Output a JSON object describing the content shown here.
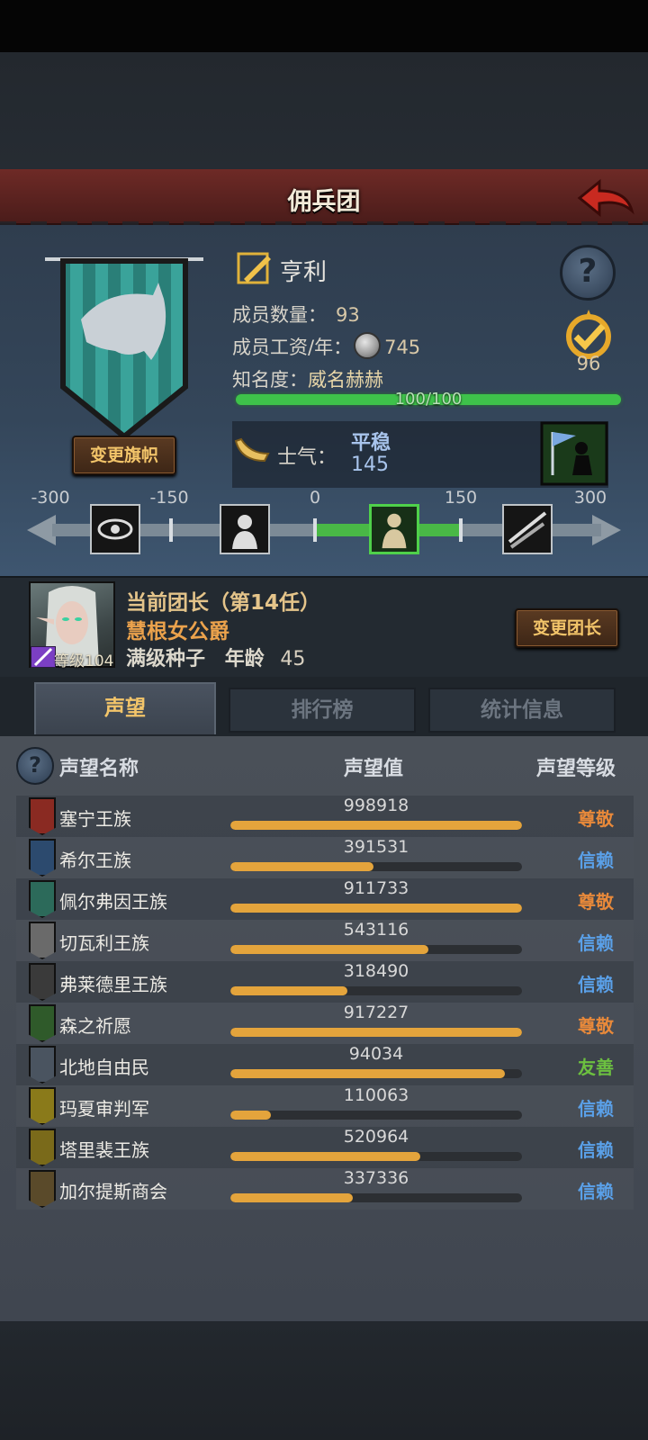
{
  "header": {
    "title": "佣兵团"
  },
  "guild": {
    "leader_name": "亨利",
    "member_count_label": "成员数量：",
    "member_count": "93",
    "wage_label": "成员工资/年：",
    "wage": "745",
    "fame_label": "知名度：",
    "fame_value": "威名赫赫",
    "fame_progress_text": "100/100",
    "fame_progress": 1.0,
    "medal_value": "96",
    "change_banner_label": "变更旗帜",
    "help_label": "?"
  },
  "morale": {
    "label": "士气：",
    "state": "平稳",
    "value": "145",
    "scale_ticks": [
      "-300",
      "-150",
      "0",
      "150",
      "300"
    ],
    "value_number": 145
  },
  "leader": {
    "title": "当前团长（第14任）",
    "name": "慧根女公爵",
    "level_label": "等级104",
    "trait": "满级种子",
    "age_label": "年龄",
    "age": "45",
    "change_leader_label": "变更团长"
  },
  "tabs": [
    {
      "label": "声望",
      "active": true
    },
    {
      "label": "排行榜",
      "active": false
    },
    {
      "label": "统计信息",
      "active": false
    }
  ],
  "reputation": {
    "help_label": "?",
    "col_name": "声望名称",
    "col_value": "声望值",
    "col_level": "声望等级",
    "rows": [
      {
        "name": "塞宁王族",
        "value": "998918",
        "fill": 1.0,
        "level": "尊敬",
        "level_color": "#e8893a",
        "icon_color": "#8a2a22"
      },
      {
        "name": "希尔王族",
        "value": "391531",
        "fill": 0.49,
        "level": "信赖",
        "level_color": "#5aa0e8",
        "icon_color": "#2c4a6e"
      },
      {
        "name": "佩尔弗因王族",
        "value": "911733",
        "fill": 1.0,
        "level": "尊敬",
        "level_color": "#e8893a",
        "icon_color": "#2c6a5a"
      },
      {
        "name": "切瓦利王族",
        "value": "543116",
        "fill": 0.68,
        "level": "信赖",
        "level_color": "#5aa0e8",
        "icon_color": "#6a6a6a"
      },
      {
        "name": "弗莱德里王族",
        "value": "318490",
        "fill": 0.4,
        "level": "信赖",
        "level_color": "#5aa0e8",
        "icon_color": "#3a3a3a"
      },
      {
        "name": "森之祈愿",
        "value": "917227",
        "fill": 1.0,
        "level": "尊敬",
        "level_color": "#e8893a",
        "icon_color": "#2f5a2a"
      },
      {
        "name": "北地自由民",
        "value": "94034",
        "fill": 0.94,
        "level": "友善",
        "level_color": "#6cc040",
        "icon_color": "#4a5460"
      },
      {
        "name": "玛夏审判军",
        "value": "110063",
        "fill": 0.14,
        "level": "信赖",
        "level_color": "#5aa0e8",
        "icon_color": "#8a7a1a"
      },
      {
        "name": "塔里裴王族",
        "value": "520964",
        "fill": 0.65,
        "level": "信赖",
        "level_color": "#5aa0e8",
        "icon_color": "#7a6a1a"
      },
      {
        "name": "加尔提斯商会",
        "value": "337336",
        "fill": 0.42,
        "level": "信赖",
        "level_color": "#5aa0e8",
        "icon_color": "#5a4a2a"
      }
    ]
  }
}
